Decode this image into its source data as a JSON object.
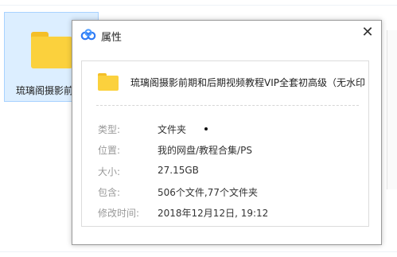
{
  "background_tile": {
    "name": "琉璃阁摄影前期和后期视频教程VIP全套初高级（无水印）",
    "icon": "folder-icon"
  },
  "dialog": {
    "title": "属性",
    "logo_icon": "baidu-netdisk-logo",
    "close_glyph": "✕",
    "folder_name": "琉璃阁摄影前期和后期视频教程VIP全套初高级（无水印...",
    "rows": [
      {
        "label": "类型:",
        "value": "文件夹"
      },
      {
        "label": "位置:",
        "value": "我的网盘/教程合集/PS"
      },
      {
        "label": "大小:",
        "value": "27.15GB"
      },
      {
        "label": "包含:",
        "value": "506个文件,77个文件夹"
      },
      {
        "label": "修改时间:",
        "value": "2018年12月12日, 19:12"
      }
    ]
  },
  "colors": {
    "selection_bg": "#dceeff",
    "selection_border": "#a8d2ff",
    "folder_yellow": "#fbd13d",
    "logo_blue": "#2f7bf5"
  }
}
